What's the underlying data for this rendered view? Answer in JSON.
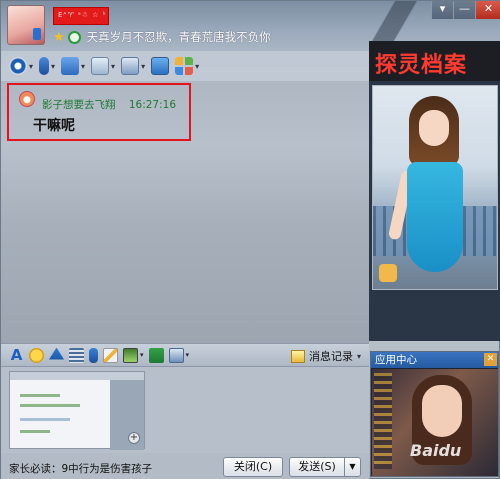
{
  "header": {
    "name_label": "Eᴬ♈ ᵃ☃ ☆ ᵇ",
    "signature": "天真岁月不忍欺，青春荒唐我不负你",
    "window_controls": [
      "▾",
      "—",
      "✕"
    ]
  },
  "toolbar": {
    "items": [
      "video-call",
      "voice-call",
      "file-transfer",
      "chat-group",
      "remote-screen",
      "share-screen",
      "apps"
    ]
  },
  "message": {
    "sender": "影子想要去飞翔",
    "time": "16:27:16",
    "text": "干嘛呢"
  },
  "right_panel": {
    "banner_title": "探灵档案"
  },
  "input_toolbar": {
    "history_label": "消息记录",
    "font_label": "A"
  },
  "footer": {
    "notice": "家长必读：9中行为是伤害孩子",
    "close_label": "关闭(C)",
    "send_label": "发送(S)",
    "send_dropdown": "▼"
  },
  "app_center": {
    "title": "应用中心",
    "close_glyph": "✕",
    "watermark": "Baidu"
  }
}
